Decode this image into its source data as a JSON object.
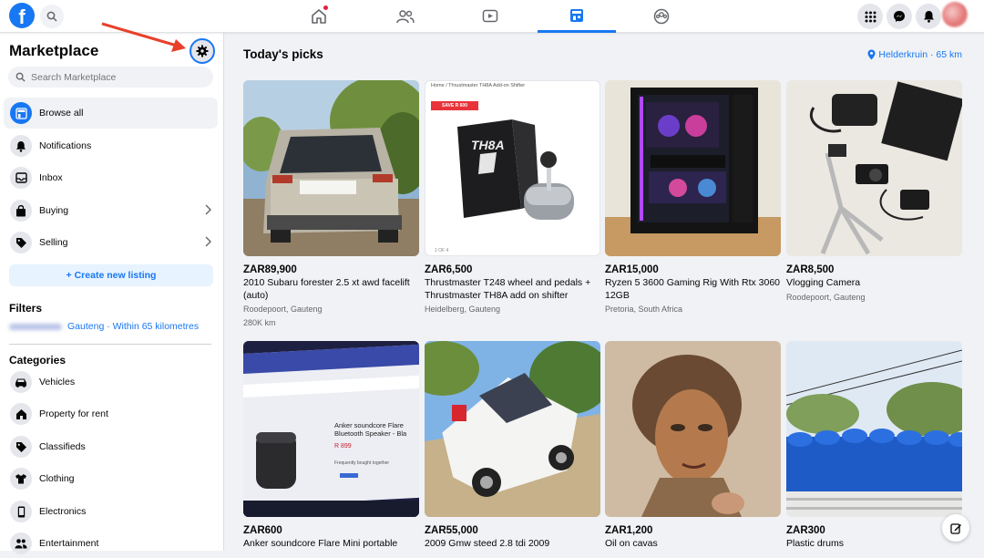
{
  "topbar": {
    "logo": "f",
    "nav_tabs": [
      {
        "name": "home",
        "icon": "home-icon",
        "notification": true
      },
      {
        "name": "friends",
        "icon": "friends-icon"
      },
      {
        "name": "watch",
        "icon": "video-icon"
      },
      {
        "name": "marketplace",
        "icon": "marketplace-icon",
        "active": true
      },
      {
        "name": "groups",
        "icon": "groups-icon"
      }
    ]
  },
  "sidebar": {
    "title": "Marketplace",
    "search_placeholder": "Search Marketplace",
    "items": [
      {
        "label": "Browse all",
        "icon": "storefront-icon"
      },
      {
        "label": "Notifications",
        "icon": "bell-icon"
      },
      {
        "label": "Inbox",
        "icon": "inbox-icon"
      },
      {
        "label": "Buying",
        "icon": "bag-icon"
      },
      {
        "label": "Selling",
        "icon": "tag-icon"
      }
    ],
    "create_label": "+ Create new listing",
    "filters_heading": "Filters",
    "filter_location": "Gauteng · Within 65 kilometres",
    "categories_heading": "Categories",
    "categories": [
      {
        "label": "Vehicles",
        "icon": "car-icon"
      },
      {
        "label": "Property for rent",
        "icon": "house-icon"
      },
      {
        "label": "Classifieds",
        "icon": "tag-icon"
      },
      {
        "label": "Clothing",
        "icon": "shirt-icon"
      },
      {
        "label": "Electronics",
        "icon": "phone-icon"
      },
      {
        "label": "Entertainment",
        "icon": "people-icon"
      }
    ]
  },
  "main": {
    "heading": "Today's picks",
    "location": "Helderkruin · 65 km",
    "listings": [
      {
        "price": "ZAR89,900",
        "title": "2010 Subaru forester 2.5 xt awd facelift (auto)",
        "location": "Roodepoort, Gauteng",
        "extra": "280K km"
      },
      {
        "price": "ZAR6,500",
        "title": "Thrustmaster T248 wheel and pedals + Thrustmaster TH8A add on shifter",
        "location": "Heidelberg, Gauteng",
        "extra": ""
      },
      {
        "price": "ZAR15,000",
        "title": "Ryzen 5 3600 Gaming Rig With Rtx 3060 12GB",
        "location": "Pretoria, South Africa",
        "extra": ""
      },
      {
        "price": "ZAR8,500",
        "title": "Vlogging Camera",
        "location": "Roodepoort, Gauteng",
        "extra": ""
      },
      {
        "price": "ZAR600",
        "title": "Anker soundcore Flare Mini portable",
        "location": "",
        "extra": ""
      },
      {
        "price": "ZAR55,000",
        "title": "2009 Gmw steed 2.8 tdi 2009",
        "location": "",
        "extra": ""
      },
      {
        "price": "ZAR1,200",
        "title": "Oil on cavas",
        "location": "",
        "extra": ""
      },
      {
        "price": "ZAR300",
        "title": "Plastic drums",
        "location": "",
        "extra": ""
      }
    ],
    "thumb_texts": {
      "shifter_breadcrumb": "Home / Thrustmaster TH8A Add-on Shifter",
      "shifter_badge": "SAVE R 600",
      "shifter_box": "TH8A",
      "shifter_counter": "1 OF 4",
      "anker_heading": "Anker soundcore Flare Bluetooth Speaker - Bla",
      "anker_price": "R 899",
      "anker_bought": "Frequently bought together"
    }
  },
  "colors": {
    "accent": "#1877f2",
    "background": "#f0f2f5",
    "annotation_arrow": "#e8402a"
  }
}
